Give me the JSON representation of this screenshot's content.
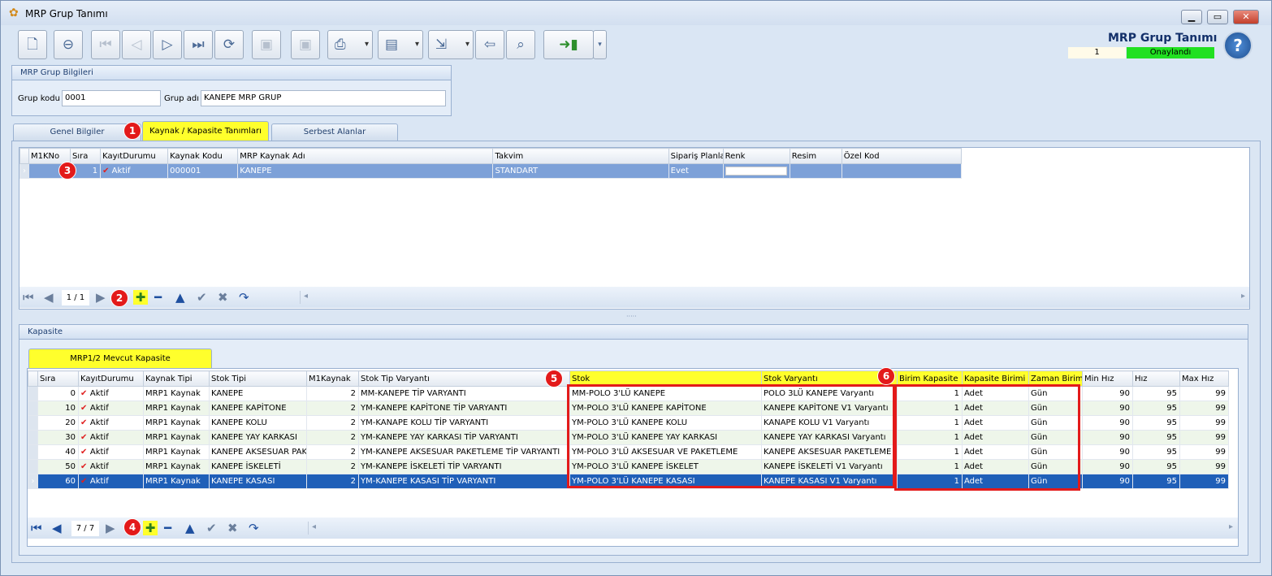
{
  "window": {
    "title": "MRP Grup Tanımı",
    "minimize": "▁",
    "maximize": "▭",
    "close": "✕"
  },
  "header": {
    "title": "MRP Grup Tanımı",
    "number": "1",
    "status": "Onaylandı",
    "help": "?"
  },
  "toolbar": {
    "icons": [
      "new-doc-icon",
      "delete-doc-icon",
      "first-icon",
      "prev-icon",
      "next-icon",
      "last-icon",
      "refresh-icon",
      "save-icon",
      "save-close-icon",
      "print-icon",
      "pdf-icon",
      "export-icon",
      "import-icon",
      "search-doc-icon",
      "exit-icon"
    ]
  },
  "group_info": {
    "title": "MRP Grup Bilgileri",
    "code_label": "Grup kodu",
    "code_value": "0001",
    "name_label": "Grup adı",
    "name_value": "KANEPE MRP GRUP"
  },
  "tabs": [
    "Genel Bilgiler",
    "Kaynak / Kapasite Tanımları",
    "Serbest Alanlar"
  ],
  "top_grid": {
    "columns": [
      "M1KNo",
      "Sıra",
      "KayıtDurumu",
      "Kaynak Kodu",
      "MRP Kaynak Adı",
      "Takvim",
      "Sipariş Planla",
      "Renk",
      "Resim",
      "Özel Kod"
    ],
    "rows": [
      [
        "",
        "1",
        "Aktif",
        "000001",
        "KANEPE",
        "STANDART",
        "Evet",
        "",
        "",
        ""
      ]
    ]
  },
  "top_nav": {
    "page": "1 / 1"
  },
  "kapasite": {
    "title": "Kapasite",
    "tab": "MRP1/2 Mevcut Kapasite"
  },
  "bottom_grid": {
    "columns": [
      "Sıra",
      "KayıtDurumu",
      "Kaynak Tipi",
      "Stok Tipi",
      "M1Kaynak",
      "Stok Tip Varyantı",
      "Stok",
      "Stok Varyantı",
      "Birim Kapasite",
      "Kapasite Birimi",
      "Zaman Birimi",
      "Min Hız",
      "Hız",
      "Max Hız"
    ],
    "rows": [
      [
        "0",
        "Aktif",
        "MRP1 Kaynak",
        "KANEPE",
        "2",
        "MM-KANEPE TİP VARYANTI",
        "MM-POLO 3'LÜ KANEPE",
        "POLO 3LÜ KANEPE Varyantı",
        "1",
        "Adet",
        "Gün",
        "90",
        "95",
        "99"
      ],
      [
        "10",
        "Aktif",
        "MRP1 Kaynak",
        "KANEPE KAPİTONE",
        "2",
        "YM-KANEPE KAPİTONE TİP VARYANTI",
        "YM-POLO 3'LÜ KANEPE KAPİTONE",
        "KANEPE KAPİTONE V1 Varyantı",
        "1",
        "Adet",
        "Gün",
        "90",
        "95",
        "99"
      ],
      [
        "20",
        "Aktif",
        "MRP1 Kaynak",
        "KANEPE KOLU",
        "2",
        "YM-KANAPE KOLU TİP VARYANTI",
        "YM-POLO 3'LÜ KANEPE KOLU",
        "KANAPE KOLU V1 Varyantı",
        "1",
        "Adet",
        "Gün",
        "90",
        "95",
        "99"
      ],
      [
        "30",
        "Aktif",
        "MRP1 Kaynak",
        "KANEPE YAY KARKASI",
        "2",
        "YM-KANEPE YAY KARKASI TİP VARYANTI",
        "YM-POLO 3'LÜ KANEPE YAY KARKASI",
        "KANEPE YAY KARKASI Varyantı",
        "1",
        "Adet",
        "Gün",
        "90",
        "95",
        "99"
      ],
      [
        "40",
        "Aktif",
        "MRP1 Kaynak",
        "KANEPE AKSESUAR PAK",
        "2",
        "YM-KANEPE AKSESUAR PAKETLEME TİP VARYANTI",
        "YM-POLO 3'LÜ AKSESUAR VE PAKETLEME",
        "KANEPE AKSESUAR PAKETLEME V",
        "1",
        "Adet",
        "Gün",
        "90",
        "95",
        "99"
      ],
      [
        "50",
        "Aktif",
        "MRP1 Kaynak",
        "KANEPE İSKELETİ",
        "2",
        "YM-KANEPE İSKELETİ TİP VARYANTI",
        "YM-POLO 3'LÜ KANEPE İSKELET",
        "KANEPE İSKELETİ V1 Varyantı",
        "1",
        "Adet",
        "Gün",
        "90",
        "95",
        "99"
      ],
      [
        "60",
        "Aktif",
        "MRP1 Kaynak",
        "KANEPE KASASI",
        "2",
        "YM-KANEPE KASASI TİP VARYANTI",
        "YM-POLO 3'LÜ KANEPE KASASI",
        "KANEPE KASASI V1 Varyantı",
        "1",
        "Adet",
        "Gün",
        "90",
        "95",
        "99"
      ]
    ]
  },
  "bottom_nav": {
    "page": "7 / 7"
  },
  "markers": [
    "1",
    "2",
    "3",
    "4",
    "5",
    "6"
  ],
  "colors": {
    "highlight": "#ffff2c",
    "marker": "#e31a1a",
    "selected_row": "#1f5fb8",
    "status_green": "#21e021"
  }
}
